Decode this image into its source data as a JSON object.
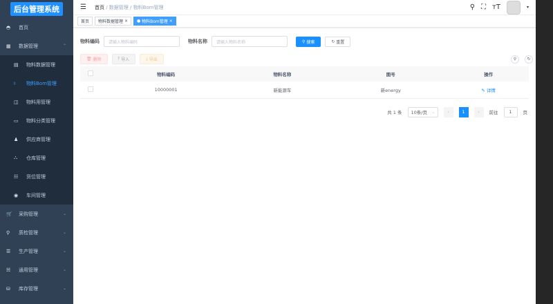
{
  "logo": "后台管理系统",
  "menu": [
    {
      "label": "首页",
      "icon": "dashboard-icon",
      "glyph": "◓"
    },
    {
      "label": "数据管理",
      "icon": "table-icon",
      "glyph": "▦",
      "expanded": true,
      "children": [
        {
          "label": "物料数据管理",
          "icon": "document-icon",
          "glyph": "▤"
        },
        {
          "label": "物料Bom管理",
          "icon": "tree-icon",
          "glyph": "⊧",
          "active": true
        },
        {
          "label": "物料用管理",
          "icon": "book-icon",
          "glyph": "◫"
        },
        {
          "label": "物料分类管理",
          "icon": "rect-icon",
          "glyph": "▭"
        },
        {
          "label": "供应商管理",
          "icon": "people-icon",
          "glyph": "♟"
        },
        {
          "label": "仓库管理",
          "icon": "warehouse-icon",
          "glyph": "⛬"
        },
        {
          "label": "货位管理",
          "icon": "list-icon",
          "glyph": "☷"
        },
        {
          "label": "车间管理",
          "icon": "radio-icon",
          "glyph": "◉"
        }
      ]
    },
    {
      "label": "采购管理",
      "icon": "cart-icon",
      "glyph": "🛒"
    },
    {
      "label": "质检管理",
      "icon": "search-icon",
      "glyph": "⚲"
    },
    {
      "label": "生产管理",
      "icon": "sliders-icon",
      "glyph": "☰"
    },
    {
      "label": "通用管理",
      "icon": "note-icon",
      "glyph": "☵"
    },
    {
      "label": "库存管理",
      "icon": "database-icon",
      "glyph": "⛁"
    }
  ],
  "breadcrumb": [
    "首页",
    "数据管理",
    "物料Bom管理"
  ],
  "tags": [
    {
      "label": "首页"
    },
    {
      "label": "物料数据管理"
    },
    {
      "label": "物料Bom管理",
      "active": true
    }
  ],
  "form": {
    "code_label": "物料编码",
    "code_placeholder": "请输入物料编码",
    "name_label": "物料名称",
    "name_placeholder": "请输入物料名称",
    "search": "搜索",
    "reset": "重置"
  },
  "toolbar": {
    "delete": "删除",
    "import": "导入",
    "export": "导出"
  },
  "table": {
    "headers": [
      "物料编码",
      "物料名称",
      "图号",
      "操作"
    ],
    "rows": [
      {
        "code": "10000001",
        "name": "新能源车",
        "drawing": "新energy",
        "action": "详情"
      }
    ]
  },
  "pagination": {
    "total": "共 1 条",
    "size": "10条/页",
    "current": "1",
    "goto": "前往",
    "goto_value": "1",
    "page_unit": "页"
  }
}
